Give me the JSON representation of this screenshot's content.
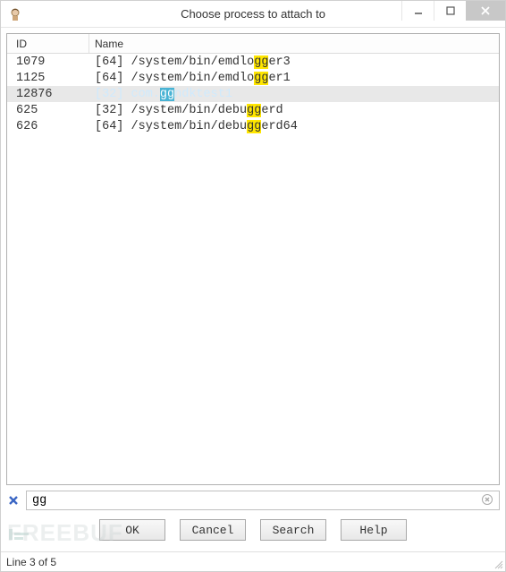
{
  "window": {
    "title": "Choose process to attach to"
  },
  "columns": {
    "id": "ID",
    "name": "Name"
  },
  "rows": [
    {
      "id": "1079",
      "bits": "[64]",
      "pre": " /system/bin/emdlo",
      "hl": "gg",
      "post": "er3",
      "selected": false
    },
    {
      "id": "1125",
      "bits": "[64]",
      "pre": " /system/bin/emdlo",
      "hl": "gg",
      "post": "er1",
      "selected": false
    },
    {
      "id": "12876",
      "bits": "[32]",
      "pre": " com.",
      "hl": "gg",
      "post": "ndktest1",
      "selected": true
    },
    {
      "id": "625",
      "bits": "[32]",
      "pre": " /system/bin/debu",
      "hl": "gg",
      "post": "erd",
      "selected": false
    },
    {
      "id": "626",
      "bits": "[64]",
      "pre": " /system/bin/debu",
      "hl": "gg",
      "post": "erd64",
      "selected": false
    }
  ],
  "search": {
    "value": "gg",
    "placeholder": ""
  },
  "buttons": {
    "ok": "OK",
    "cancel": "Cancel",
    "search": "Search",
    "help": "Help"
  },
  "status": {
    "text": "Line 3 of 5"
  },
  "watermark": {
    "text": "FREEBUF"
  }
}
